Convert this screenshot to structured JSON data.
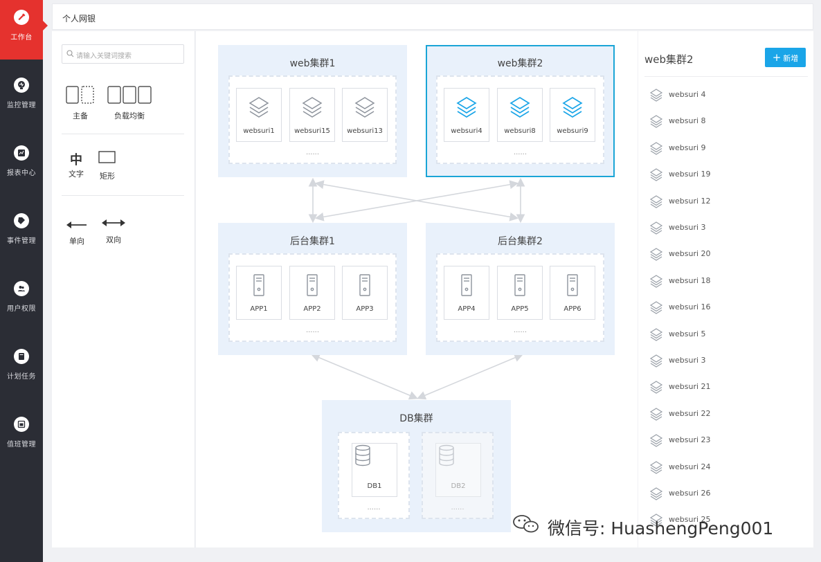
{
  "sidebar": {
    "items": [
      {
        "label": "工作台",
        "icon": "wrench-icon",
        "active": true
      },
      {
        "label": "监控管理",
        "icon": "monitor-icon"
      },
      {
        "label": "报表中心",
        "icon": "report-icon"
      },
      {
        "label": "事件管理",
        "icon": "tag-icon"
      },
      {
        "label": "用户权限",
        "icon": "users-icon"
      },
      {
        "label": "计划任务",
        "icon": "task-icon"
      },
      {
        "label": "值班管理",
        "icon": "calendar-icon"
      }
    ]
  },
  "header": {
    "title": "个人网银"
  },
  "toolbox": {
    "search_placeholder": "请输入关键词搜索",
    "tools": {
      "primary_backup": "主备",
      "load_balance": "负载均衡",
      "text": "文字",
      "text_glyph": "中",
      "rectangle": "矩形",
      "one_way": "单向",
      "two_way": "双向"
    }
  },
  "topology": {
    "web1": {
      "title": "web集群1",
      "nodes": [
        "websuri1",
        "websuri15",
        "websuri13"
      ],
      "more": "......"
    },
    "web2": {
      "title": "web集群2",
      "nodes": [
        "websuri4",
        "websuri8",
        "websuri9"
      ],
      "more": "......"
    },
    "app1": {
      "title": "后台集群1",
      "nodes": [
        "APP1",
        "APP2",
        "APP3"
      ],
      "more": "......"
    },
    "app2": {
      "title": "后台集群2",
      "nodes": [
        "APP4",
        "APP5",
        "APP6"
      ],
      "more": "......"
    },
    "db": {
      "title": "DB集群",
      "nodes": [
        "DB1",
        "DB2"
      ],
      "more": [
        "......",
        "......"
      ]
    }
  },
  "detail": {
    "title": "web集群2",
    "add_label": "新增",
    "items": [
      "websuri 4",
      "websuri 8",
      "websuri 9",
      "websuri 19",
      "websuri 12",
      "websuri 3",
      "websuri 20",
      "websuri 18",
      "websuri 16",
      "websuri 5",
      "websuri 3",
      "websuri 21",
      "websuri 22",
      "websuri 23",
      "websuri 24",
      "websuri 26",
      "websuri 25"
    ]
  },
  "watermark": {
    "text": "微信号: HuashengPeng001"
  },
  "colors": {
    "accent": "#1aa5e8",
    "sidebar_bg": "#2b2d35",
    "active_nav": "#e5322e",
    "cluster_bg": "#e9f1fb",
    "selected_border": "#1aa5d6"
  }
}
